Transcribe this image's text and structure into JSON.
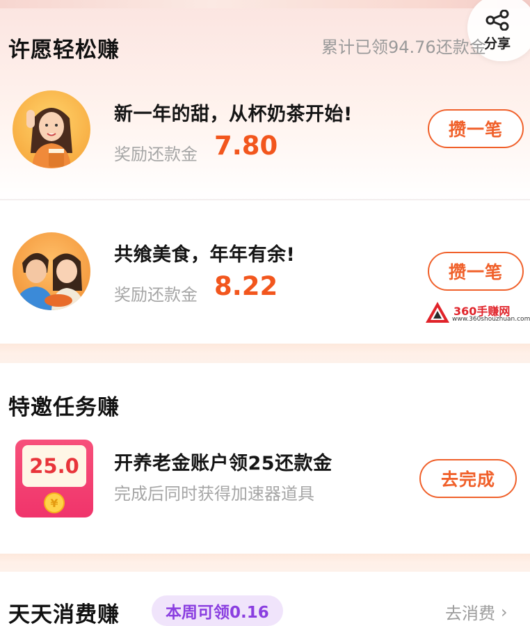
{
  "share": {
    "label": "分享",
    "icon": "share-icon"
  },
  "wish_section": {
    "title": "许愿轻松赚",
    "cumulative": "累计已领94.76还款金",
    "tasks": [
      {
        "title": "新一年的甜，从杯奶茶开始!",
        "reward_label": "奖励还款金",
        "reward_value": "7.80",
        "button": "攒一笔",
        "avatar": "woman-milk-tea-avatar"
      },
      {
        "title": "共飨美食，年年有余!",
        "reward_label": "奖励还款金",
        "reward_value": "8.22",
        "button": "攒一笔",
        "avatar": "couple-food-avatar"
      }
    ]
  },
  "watermark": {
    "name": "360手赚网",
    "url": "www.360shouzhuan.com"
  },
  "invite_section": {
    "title": "特邀任务赚",
    "task": {
      "card_amount": "25.0",
      "title": "开养老金账户领25还款金",
      "desc": "完成后同时获得加速器道具",
      "button": "去完成",
      "icon": "red-envelope-icon"
    }
  },
  "daily_section": {
    "title": "天天消费赚",
    "badge": "本周可领0.16",
    "link": "去消费",
    "link_icon": "chevron-right-icon"
  },
  "colors": {
    "accent": "#f0602a",
    "reward": "#f2561d",
    "badge_bg": "#f0e4fb",
    "badge_text": "#8a3ee0"
  }
}
